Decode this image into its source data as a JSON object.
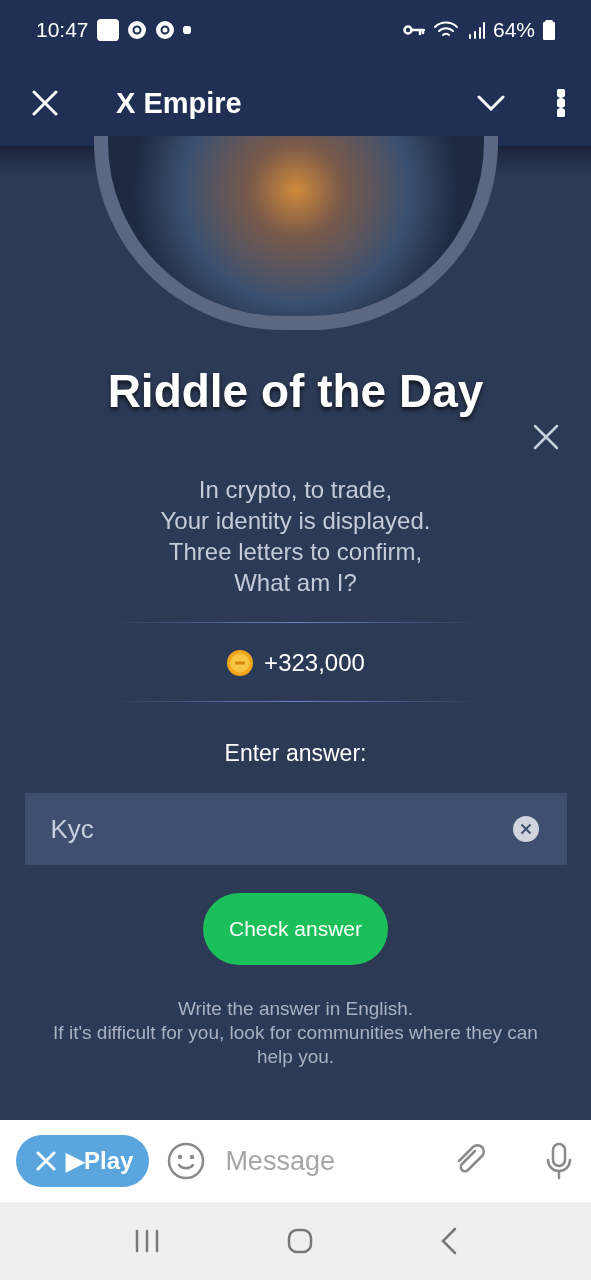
{
  "status_bar": {
    "time": "10:47",
    "battery": "64%"
  },
  "app_bar": {
    "title": "X Empire"
  },
  "riddle": {
    "title": "Riddle of the Day",
    "text": "In crypto, to trade,\nYour identity is displayed.\nThree letters to confirm,\nWhat am I?",
    "reward": "+323,000",
    "answer_label": "Enter answer:",
    "answer_value": "Kyc",
    "check_button": "Check answer",
    "hint": "Write the answer in English.\nIf it's difficult for you, look for communities where they can help you."
  },
  "composer": {
    "bot_button": "▶Play",
    "placeholder": "Message"
  }
}
